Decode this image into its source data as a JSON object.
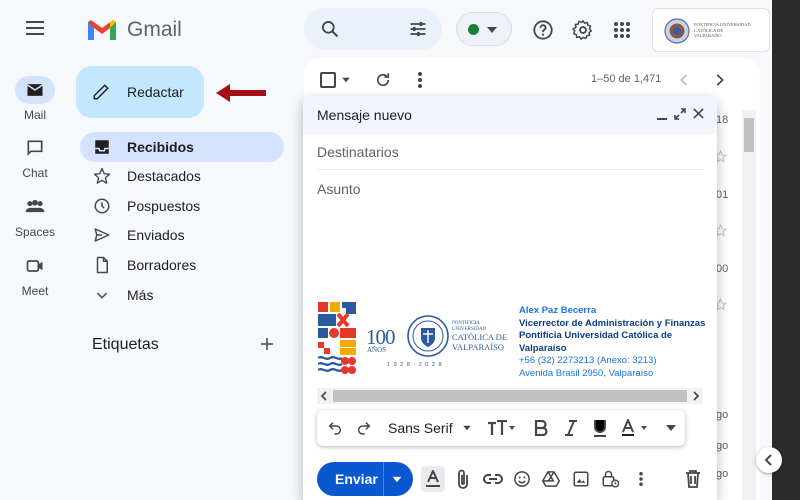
{
  "app": {
    "name": "Gmail"
  },
  "rail": [
    {
      "label": "Mail",
      "icon": "mail-icon",
      "active": true
    },
    {
      "label": "Chat",
      "icon": "chat-icon"
    },
    {
      "label": "Spaces",
      "icon": "spaces-icon"
    },
    {
      "label": "Meet",
      "icon": "meet-icon"
    }
  ],
  "compose_button": {
    "label": "Redactar"
  },
  "nav": [
    {
      "label": "Recibidos",
      "icon": "inbox-icon",
      "active": true
    },
    {
      "label": "Destacados",
      "icon": "star-icon"
    },
    {
      "label": "Pospuestos",
      "icon": "clock-icon"
    },
    {
      "label": "Enviados",
      "icon": "send-icon"
    },
    {
      "label": "Borradores",
      "icon": "draft-icon"
    },
    {
      "label": "Más",
      "icon": "chevron-down-icon"
    }
  ],
  "labels_section": {
    "title": "Etiquetas"
  },
  "toolbar": {
    "pagination": "1–50 de 1,471"
  },
  "list_peek": [
    "18",
    "01",
    "00",
    "go",
    "go",
    "go"
  ],
  "compose": {
    "title": "Mensaje nuevo",
    "to_placeholder": "Destinatarios",
    "subject_placeholder": "Asunto",
    "send_label": "Enviar",
    "font_name": "Sans Serif"
  },
  "signature": {
    "name": "Alex Paz Becerra",
    "role": "Vicerrector de Administración y Finanzas",
    "org": "Pontificia Universidad Católica de Valparaíso",
    "phone": "+56 (32) 2273213 (Anexo: 3213)",
    "address": "Avenida Brasil 2950, Valparaíso",
    "logo_anniv": "100",
    "logo_anos": "AÑOS",
    "logo_years": "1 9 2 8 · 2 0 2 8",
    "logo_small_1": "PONTIFICIA",
    "logo_small_2": "UNIVERSIDAD",
    "logo_big_1": "CATÓLICA DE",
    "logo_big_2": "VALPARAÍSO"
  },
  "header_logo": {
    "line1": "PONTIFICIA UNIVERSIDAD",
    "line2": "CATÓLICA DE",
    "line3": "VALPARAÍSO"
  },
  "colors": {
    "accent": "#0b57d0",
    "nav_active": "#d3e3fd",
    "compose_bg": "#c2e7ff",
    "arrow": "#a50f15",
    "status_green": "#188038",
    "signature_blue": "#1a73e8",
    "signature_navy": "#0b3a85"
  }
}
